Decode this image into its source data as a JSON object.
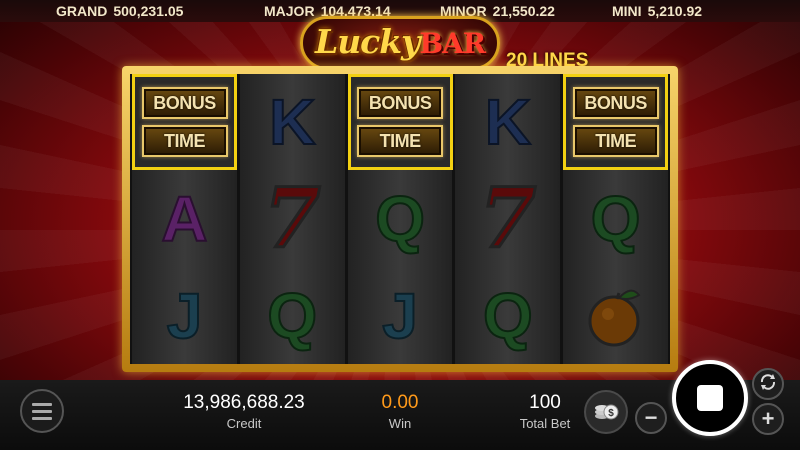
{
  "jackpots": {
    "grand": {
      "label": "GRAND",
      "value": "500,231.05"
    },
    "major": {
      "label": "MAJOR",
      "value": "104,473.14"
    },
    "minor": {
      "label": "MINOR",
      "value": "21,550.22"
    },
    "mini": {
      "label": "MINI",
      "value": "5,210.92"
    }
  },
  "logo": {
    "word1": "Lucky",
    "word2": "BAR",
    "lines": "20 LINES"
  },
  "reels": [
    [
      {
        "type": "bonus",
        "top": "BONUS",
        "bottom": "TIME"
      },
      {
        "type": "letter",
        "text": "A",
        "cls": "sym-A"
      },
      {
        "type": "letter",
        "text": "J",
        "cls": "sym-J"
      }
    ],
    [
      {
        "type": "letter",
        "text": "K",
        "cls": "sym-K"
      },
      {
        "type": "seven",
        "text": "7"
      },
      {
        "type": "letter",
        "text": "Q",
        "cls": "sym-Q"
      }
    ],
    [
      {
        "type": "bonus",
        "top": "BONUS",
        "bottom": "TIME"
      },
      {
        "type": "letter",
        "text": "Q",
        "cls": "sym-Q"
      },
      {
        "type": "letter",
        "text": "J",
        "cls": "sym-J"
      }
    ],
    [
      {
        "type": "letter",
        "text": "K",
        "cls": "sym-K"
      },
      {
        "type": "seven",
        "text": "7"
      },
      {
        "type": "letter",
        "text": "Q",
        "cls": "sym-Q"
      }
    ],
    [
      {
        "type": "bonus",
        "top": "BONUS",
        "bottom": "TIME"
      },
      {
        "type": "letter",
        "text": "Q",
        "cls": "sym-Q"
      },
      {
        "type": "orange",
        "icon": "orange-icon"
      }
    ]
  ],
  "stats": {
    "credit": {
      "value": "13,986,688.23",
      "label": "Credit"
    },
    "win": {
      "value": "0.00",
      "label": "Win"
    },
    "total_bet": {
      "value": "100",
      "label": "Total Bet"
    }
  },
  "controls": {
    "minus": "−",
    "plus": "+",
    "icons": [
      "menu-icon",
      "coins-icon",
      "autoplay-icon",
      "stop-icon"
    ]
  },
  "colors": {
    "highlight": "#f2d012",
    "win": "#ff9a1a",
    "frame": "#e0a82a"
  }
}
